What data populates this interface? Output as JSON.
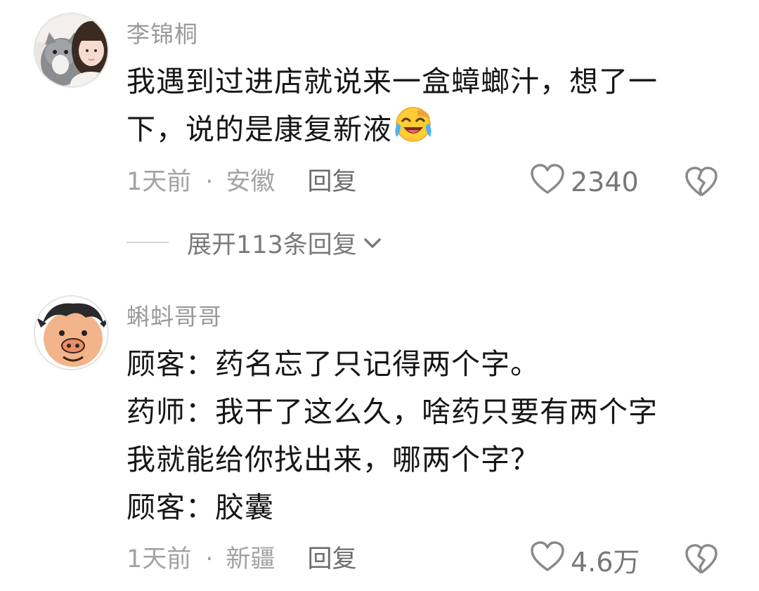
{
  "comments": [
    {
      "username": "李锦桐",
      "avatar_icon": "user-avatar-girl-with-cat",
      "lines": [
        "我遇到过进店就说来一盒蟑螂汁，想了一",
        "下，说的是康复新液"
      ],
      "emoji": "laughing-crying-emoji",
      "time": "1天前",
      "separator": "·",
      "location": "安徽",
      "reply_label": "回复",
      "likes": "2340",
      "expand_label": "展开113条回复"
    },
    {
      "username": "蝌蚪哥哥",
      "avatar_icon": "user-avatar-cartoon-pig",
      "lines": [
        "顾客：药名忘了只记得两个字。",
        "药师：我干了这么久，啥药只要有两个字",
        "我就能给你找出来，哪两个字？",
        "顾客：胶囊"
      ],
      "time": "1天前",
      "separator": "·",
      "location": "新疆",
      "reply_label": "回复",
      "likes": "4.6万"
    }
  ],
  "colors": {
    "text": "#161616",
    "meta": "#a3a3a3",
    "username": "#9a9a9a"
  }
}
